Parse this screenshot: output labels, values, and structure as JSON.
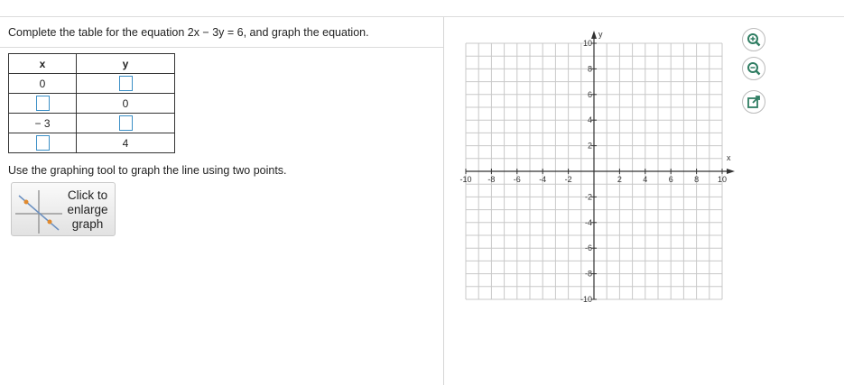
{
  "question": {
    "text": "Complete the table for the equation 2x − 3y = 6, and graph the equation."
  },
  "table": {
    "headers": [
      "x",
      "y"
    ],
    "rows": [
      {
        "x": "0",
        "y": ""
      },
      {
        "x": "",
        "y": "0"
      },
      {
        "x": "− 3",
        "y": ""
      },
      {
        "x": "",
        "y": "4"
      }
    ]
  },
  "instruction": {
    "text": "Use the graphing tool to graph the line using two points."
  },
  "enlarge_button": {
    "line1": "Click to",
    "line2": "enlarge",
    "line3": "graph"
  },
  "graph": {
    "x_axis_label": "x",
    "y_axis_label": "y",
    "x_ticks": [
      "-10",
      "-8",
      "-6",
      "-4",
      "-2",
      "2",
      "4",
      "6",
      "8",
      "10"
    ],
    "y_ticks": [
      "10",
      "8",
      "6",
      "4",
      "2",
      "-2",
      "-4",
      "-6",
      "-8",
      "-10"
    ],
    "x_range": [
      -10,
      10
    ],
    "y_range": [
      -10,
      10
    ],
    "grid": true,
    "grid_color": "#c8c8c8"
  },
  "tools": [
    "zoom-in-icon",
    "zoom-out-icon",
    "popout-icon"
  ],
  "colors": {
    "input_border": "#3b8fc6",
    "tool_icon": "#2f7d62"
  }
}
